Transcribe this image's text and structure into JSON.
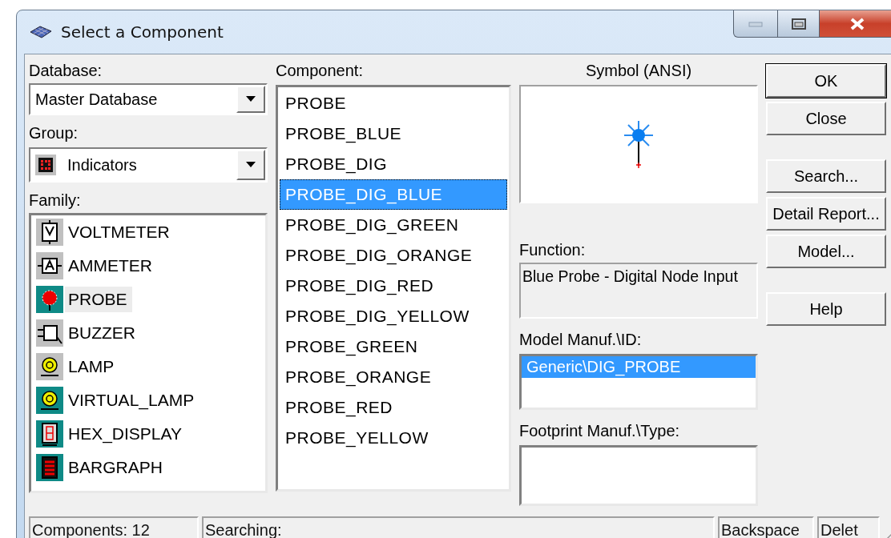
{
  "window": {
    "title": "Select a Component"
  },
  "database": {
    "label": "Database:",
    "value": "Master Database"
  },
  "group": {
    "label": "Group:",
    "value": "Indicators"
  },
  "family": {
    "label": "Family:",
    "items": [
      {
        "label": "VOLTMETER",
        "kind": "voltmeter",
        "selected": false
      },
      {
        "label": "AMMETER",
        "kind": "ammeter",
        "selected": false
      },
      {
        "label": "PROBE",
        "kind": "probe",
        "selected": true
      },
      {
        "label": "BUZZER",
        "kind": "buzzer",
        "selected": false
      },
      {
        "label": "LAMP",
        "kind": "lamp",
        "selected": false
      },
      {
        "label": "VIRTUAL_LAMP",
        "kind": "virtual_lamp",
        "selected": false
      },
      {
        "label": "HEX_DISPLAY",
        "kind": "hex_display",
        "selected": false
      },
      {
        "label": "BARGRAPH",
        "kind": "bargraph",
        "selected": false
      }
    ]
  },
  "component": {
    "label": "Component:",
    "items": [
      {
        "label": "PROBE",
        "selected": false
      },
      {
        "label": "PROBE_BLUE",
        "selected": false
      },
      {
        "label": "PROBE_DIG",
        "selected": false
      },
      {
        "label": "PROBE_DIG_BLUE",
        "selected": true
      },
      {
        "label": "PROBE_DIG_GREEN",
        "selected": false
      },
      {
        "label": "PROBE_DIG_ORANGE",
        "selected": false
      },
      {
        "label": "PROBE_DIG_RED",
        "selected": false
      },
      {
        "label": "PROBE_DIG_YELLOW",
        "selected": false
      },
      {
        "label": "PROBE_GREEN",
        "selected": false
      },
      {
        "label": "PROBE_ORANGE",
        "selected": false
      },
      {
        "label": "PROBE_RED",
        "selected": false
      },
      {
        "label": "PROBE_YELLOW",
        "selected": false
      }
    ]
  },
  "symbol": {
    "label": "Symbol (ANSI)"
  },
  "function": {
    "label": "Function:",
    "value": "Blue Probe - Digital Node Input"
  },
  "model": {
    "label": "Model Manuf.\\ID:",
    "items": [
      {
        "label": "Generic\\DIG_PROBE",
        "selected": true
      }
    ]
  },
  "footprint": {
    "label": "Footprint Manuf.\\Type:"
  },
  "buttons": [
    {
      "label": "OK",
      "kind": "default"
    },
    {
      "label": "Close",
      "kind": "normal"
    },
    {
      "label": "Search...",
      "kind": "gap"
    },
    {
      "label": "Detail Report...",
      "kind": "normal"
    },
    {
      "label": "Model...",
      "kind": "normal"
    },
    {
      "label": "Help",
      "kind": "gap"
    }
  ],
  "status_bar": [
    "Components: 12",
    "Searching:",
    "Backspace",
    "Delet"
  ]
}
